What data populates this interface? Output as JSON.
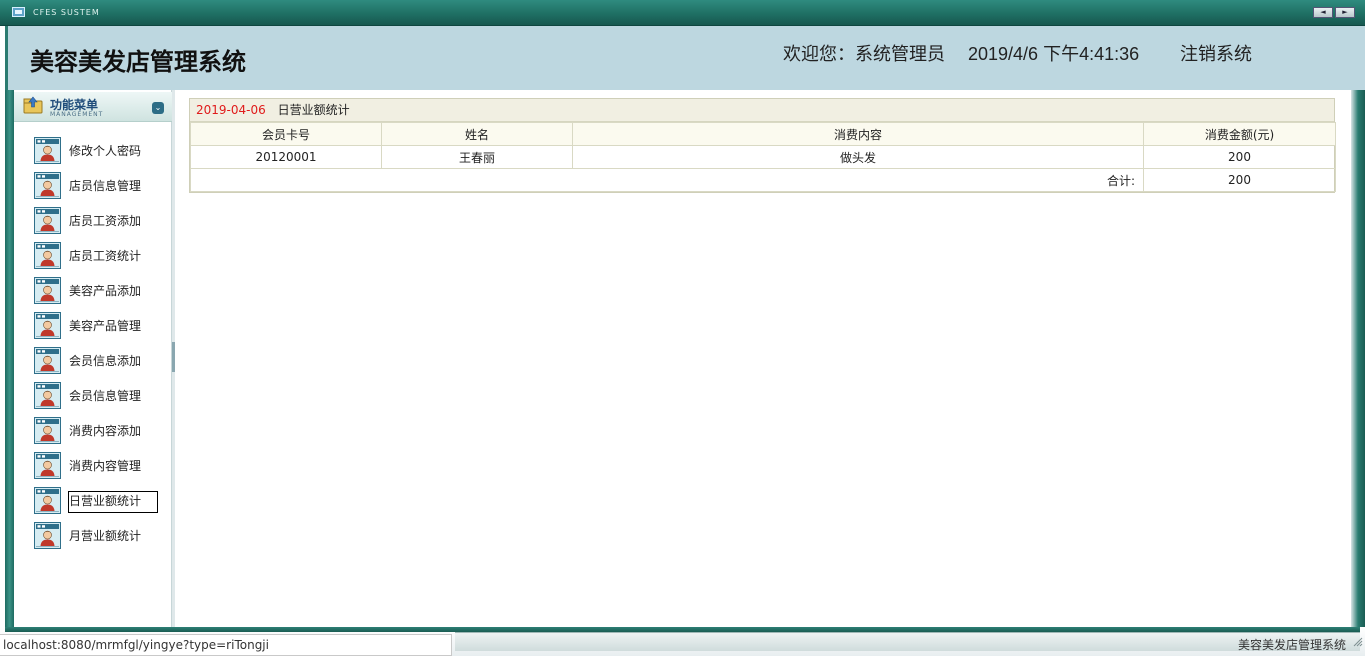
{
  "window": {
    "system_label": "CFES SUSTEM",
    "nav_prev": "◄",
    "nav_next": "►"
  },
  "header": {
    "app_title": "美容美发店管理系统",
    "welcome": "欢迎您：系统管理员",
    "datetime": "2019/4/6 下午4:41:36",
    "logout": "注销系统"
  },
  "sidebar": {
    "menu_title": "功能菜单",
    "menu_subtitle": "MANAGEMENT",
    "collapse_icon": "chevron-double-down-icon",
    "items": [
      {
        "label": "修改个人密码",
        "icon": "user-card-icon"
      },
      {
        "label": "店员信息管理",
        "icon": "user-card-icon"
      },
      {
        "label": "店员工资添加",
        "icon": "user-card-icon"
      },
      {
        "label": "店员工资统计",
        "icon": "user-card-icon"
      },
      {
        "label": "美容产品添加",
        "icon": "user-card-icon"
      },
      {
        "label": "美容产品管理",
        "icon": "user-card-icon"
      },
      {
        "label": "会员信息添加",
        "icon": "user-card-icon"
      },
      {
        "label": "会员信息管理",
        "icon": "user-card-icon"
      },
      {
        "label": "消费内容添加",
        "icon": "user-card-icon"
      },
      {
        "label": "消费内容管理",
        "icon": "user-card-icon"
      },
      {
        "label": "日营业额统计",
        "icon": "user-card-icon",
        "active": true
      },
      {
        "label": "月营业额统计",
        "icon": "user-card-icon"
      }
    ]
  },
  "report": {
    "date": "2019-04-06",
    "title": "日营业额统计",
    "columns": [
      "会员卡号",
      "姓名",
      "消费内容",
      "消费金额(元)"
    ],
    "rows": [
      {
        "card_no": "20120001",
        "name": "王春丽",
        "content": "做头发",
        "amount": "200"
      }
    ],
    "total_label": "合计:",
    "total_value": "200"
  },
  "status": {
    "url": "localhost:8080/mrmfgl/yingye?type=riTongji",
    "footer_name": "美容美发店管理系统"
  },
  "colors": {
    "frame_dark": "#1e6b61",
    "header_bg": "#bdd7e0",
    "date_red": "#e01b1b"
  }
}
